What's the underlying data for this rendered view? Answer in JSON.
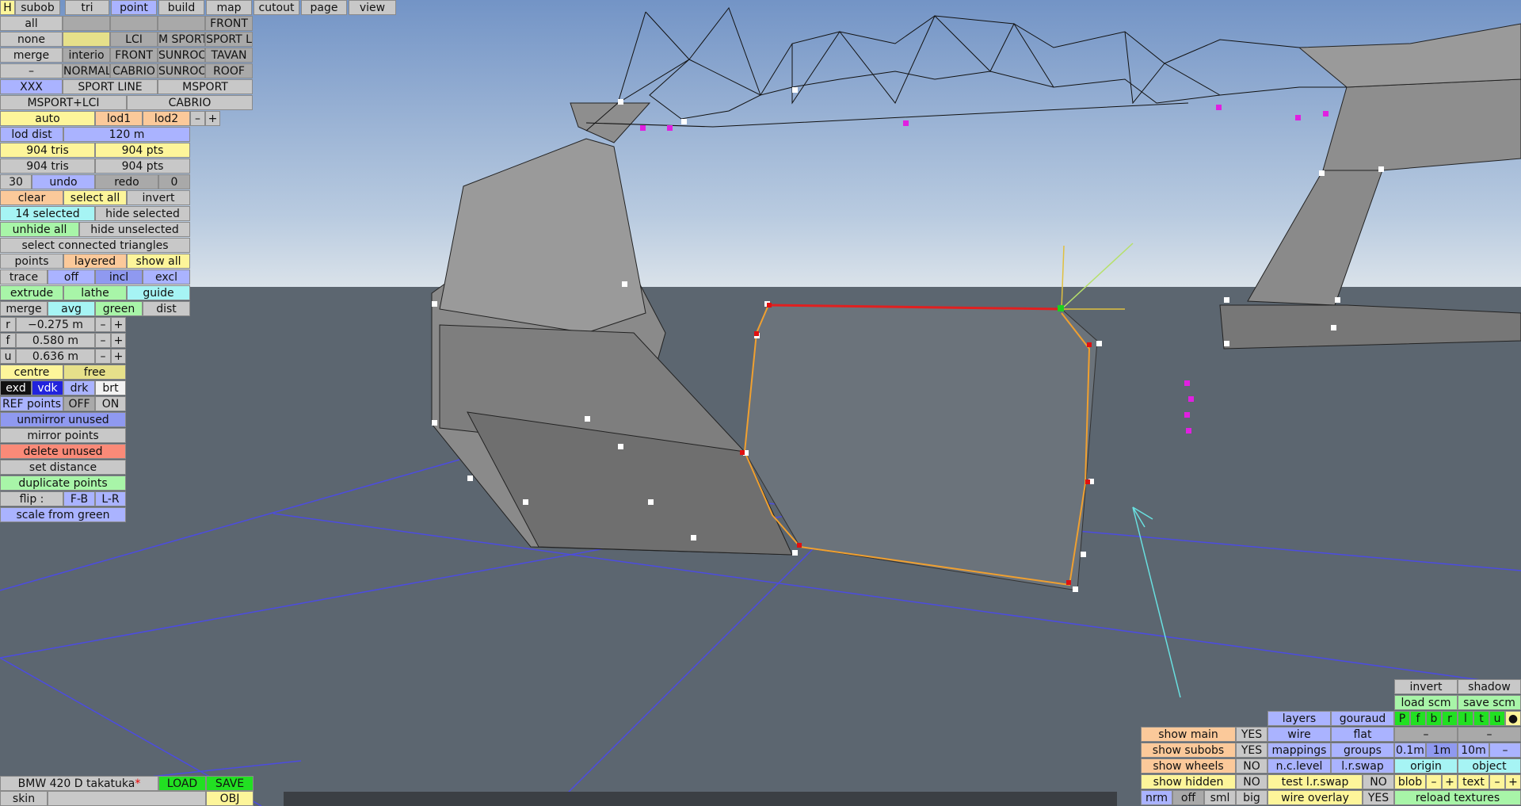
{
  "top_tabs": [
    "H",
    "subob",
    "tri",
    "point",
    "build",
    "map",
    "cutout",
    "page",
    "view"
  ],
  "row1": {
    "all": "all",
    "front": "FRONT"
  },
  "row2": {
    "none": "none",
    "lci": "LCI",
    "msport": "M SPORT",
    "sportl": "SPORT L"
  },
  "row3": {
    "merge": "merge",
    "interio": "interio",
    "front": "FRONT",
    "sunroof": "SUNROOF",
    "tavan": "TAVAN"
  },
  "row4": {
    "dash": "–",
    "normall": "NORMALL",
    "cabrio": "CABRIO",
    "sunroof": "SUNROOF",
    "roof": "ROOF"
  },
  "row5": {
    "xxx": "XXX",
    "sportline": "SPORT LINE",
    "msport": "MSPORT"
  },
  "row6": {
    "msportlci": "MSPORT+LCI",
    "cabrio": "CABRIO"
  },
  "lod": {
    "auto": "auto",
    "lod1": "lod1",
    "lod2": "lod2",
    "minus": "–",
    "plus": "+",
    "dist_label": "lod dist",
    "dist_value": "120 m"
  },
  "counts": {
    "tris1": "904 tris",
    "pts1": "904 pts",
    "tris2": "904 tris",
    "pts2": "904 pts"
  },
  "undo": {
    "n": "30",
    "undo": "undo",
    "redo": "redo",
    "zero": "0"
  },
  "sel": {
    "clear": "clear",
    "select_all": "select all",
    "invert": "invert",
    "selected": "14 selected",
    "hide_selected": "hide selected",
    "unhide_all": "unhide all",
    "hide_unselected": "hide unselected",
    "select_connected": "select connected triangles"
  },
  "points_row": {
    "points": "points",
    "layered": "layered",
    "show_all": "show all"
  },
  "trace_row": {
    "trace": "trace",
    "off": "off",
    "incl": "incl",
    "excl": "excl"
  },
  "extrude_row": {
    "extrude": "extrude",
    "lathe": "lathe",
    "guide": "guide"
  },
  "merge_row": {
    "merge": "merge",
    "avg": "avg",
    "green": "green",
    "dist": "dist"
  },
  "coords": [
    {
      "axis": "r",
      "value": "−0.275 m"
    },
    {
      "axis": "f",
      "value": "0.580 m"
    },
    {
      "axis": "u",
      "value": "0.636 m"
    }
  ],
  "centre_row": {
    "centre": "centre",
    "free": "free"
  },
  "view_row": {
    "exd": "exd",
    "vdk": "vdk",
    "drk": "drk",
    "brt": "brt"
  },
  "ref_row": {
    "ref": "REF points",
    "off": "OFF",
    "on": "ON"
  },
  "tools": [
    "unmirror unused",
    "mirror points",
    "delete unused",
    "set distance",
    "duplicate points"
  ],
  "flip": {
    "label": "flip :",
    "fb": "F-B",
    "lr": "L-R"
  },
  "scale_green": "scale from green",
  "file": {
    "name": "BMW 420 D takatuka",
    "star": "*",
    "load": "LOAD",
    "save": "SAVE",
    "skin": "skin",
    "obj": "OBJ"
  },
  "rb": {
    "invert": "invert",
    "shadow": "shadow",
    "load_scm": "load scm",
    "save_scm": "save scm",
    "layers": "layers",
    "gouraud": "gouraud",
    "pfbrltu": [
      "P",
      "f",
      "b",
      "r",
      "l",
      "t",
      "u"
    ],
    "dot": "●",
    "wire": "wire",
    "flat": "flat",
    "dash": "–",
    "mappings": "mappings",
    "groups": "groups",
    "z01": "0.1m",
    "z1": "1m",
    "z10": "10m",
    "nclevel": "n.c.level",
    "lrswap": "l.r.swap",
    "origin": "origin",
    "object": "object",
    "test_lrswap": "test l.r.swap",
    "no": "NO",
    "blob": "blob",
    "minus": "–",
    "plus": "+",
    "text": "text",
    "wire_overlay": "wire overlay",
    "yes": "YES",
    "reload": "reload textures",
    "show_main": "show main",
    "show_subobs": "show subobs",
    "show_wheels": "show wheels",
    "show_hidden": "show hidden",
    "nrm": "nrm",
    "off": "off",
    "sml": "sml",
    "big": "big"
  },
  "colors": {
    "sky_top": "#7a9cc8",
    "sky_bottom": "#d8e2ea",
    "ground": "#5c6670",
    "grid": "#4a4ae6",
    "selection": "#ff8c00"
  }
}
